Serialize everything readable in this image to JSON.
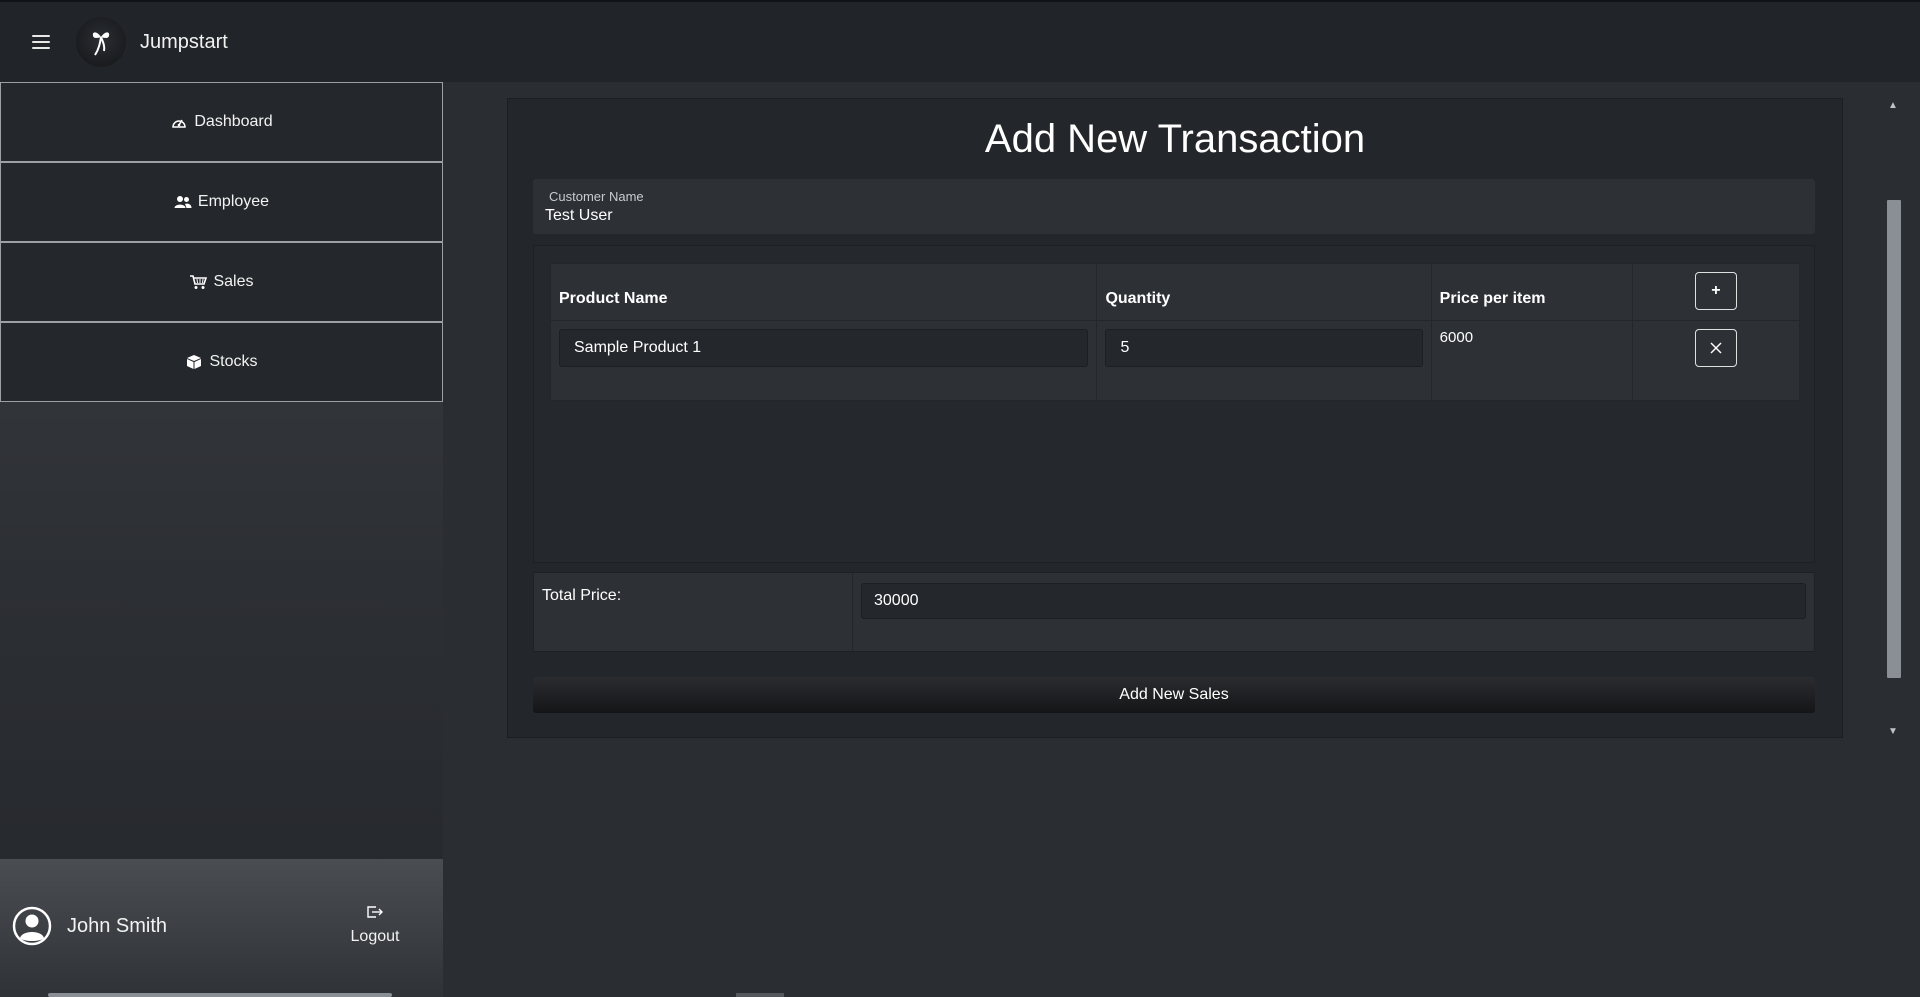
{
  "app": {
    "brand": "Jumpstart"
  },
  "sidebar": {
    "items": [
      {
        "label": "Dashboard",
        "icon": "gauge-icon"
      },
      {
        "label": "Employee",
        "icon": "users-icon"
      },
      {
        "label": "Sales",
        "icon": "cart-icon"
      },
      {
        "label": "Stocks",
        "icon": "box-icon"
      }
    ],
    "user": {
      "name": "John Smith",
      "logout_label": "Logout"
    }
  },
  "form": {
    "title": "Add New Transaction",
    "customer_label": "Customer Name",
    "customer_value": "Test User",
    "columns": [
      "Product Name",
      "Quantity",
      "Price per item"
    ],
    "add_button": "+",
    "rows": [
      {
        "product": "Sample Product 1",
        "quantity": "5",
        "price": "6000"
      }
    ],
    "total_label": "Total Price:",
    "total_value": "30000",
    "submit_label": "Add New Sales"
  }
}
